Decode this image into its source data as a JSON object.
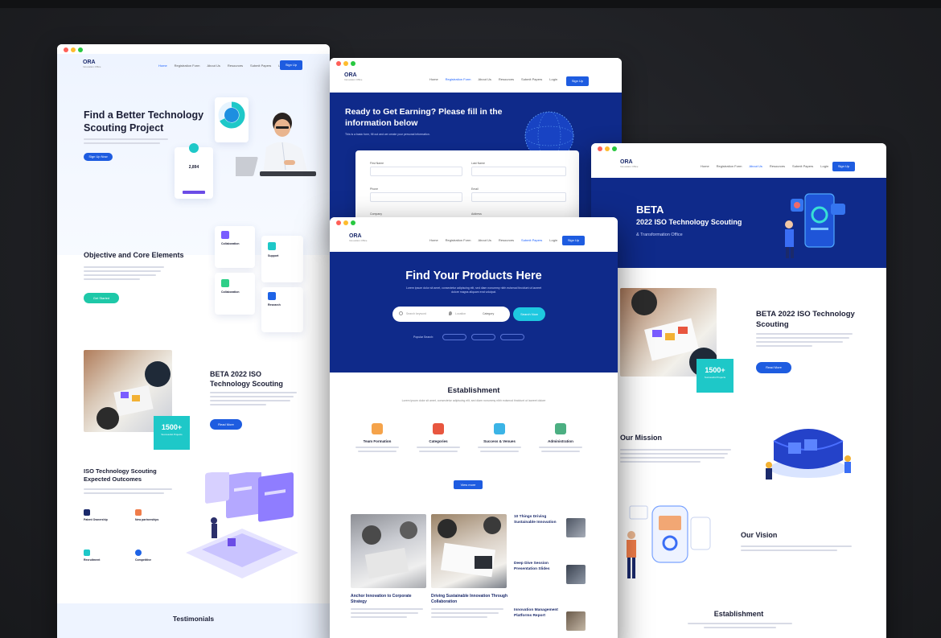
{
  "colors": {
    "brand_blue": "#0f2a8a",
    "accent_blue": "#1e5ce0",
    "teal": "#1ec8c8",
    "background": "#1f2024"
  },
  "nav": {
    "logo": "ORA",
    "links": [
      "Home",
      "Registration Form",
      "About Us",
      "Resources",
      "Submit Papers",
      "Login"
    ],
    "signup": "Sign Up"
  },
  "w1": {
    "hero_title": "Find a Better Technology Scouting Project",
    "hero_btn": "Sign Up Now",
    "stat_card_value": "2,894",
    "objective_title": "Objective and Core Elements",
    "objective_btn": "Get Started",
    "feature_cards": [
      {
        "title": "Collaboration",
        "icon": "puzzle-icon"
      },
      {
        "title": "Support",
        "icon": "chat-icon"
      },
      {
        "title": "Collaboration",
        "icon": "handshake-icon"
      },
      {
        "title": "Research",
        "icon": "search-icon"
      }
    ],
    "beta_title": "BETA 2022 ISO Technology Scouting",
    "beta_btn": "Read More",
    "badge_value": "1500+",
    "badge_label": "Successful Projects",
    "outcomes_title": "ISO Technology Scouting Expected Outcomes",
    "outcome_items": [
      "Patent Ownership",
      "New partnerships",
      "Recruitment",
      "Competitive"
    ],
    "testimonials_title": "Testimonials"
  },
  "w2": {
    "hero_title": "Ready to Get Earning? Please fill in the information below",
    "hero_sub": "This is a basic form, fill out and we create your personal information.",
    "fields": [
      "First Name",
      "Last Name",
      "Phone",
      "Email",
      "Company",
      "Address"
    ]
  },
  "w3": {
    "hero_title": "BETA",
    "hero_sub": "2022 ISO Technology Scouting",
    "hero_sub2": "& Transformation Office",
    "beta_title": "BETA 2022 ISO Technology Scouting",
    "badge_value": "1500+",
    "badge_label": "Successful Projects",
    "beta_btn": "Read More",
    "mission_title": "Our Mission",
    "vision_title": "Our Vision",
    "establishment_title": "Establishment"
  },
  "w4": {
    "hero_title": "Find Your Products Here",
    "hero_sub": "Lorem ipsum dolor sit amet, consectetur adipiscing elit, sed diam nonummy nibh euismod tincidunt ut laoreet dolore magna aliquam erat volutpat.",
    "search_placeholder": "Search keyword",
    "location_placeholder": "Location",
    "category_placeholder": "Category",
    "search_btn": "Search Now",
    "popular_label": "Popular Search:",
    "establishment_title": "Establishment",
    "establishment_sub": "Lorem ipsum dolor sit amet, consectetur adipiscing elit, sed diam nonummy nibh euismod tincidunt ut laoreet dolore",
    "categories": [
      {
        "title": "Team Formation",
        "color": "#f5a34a"
      },
      {
        "title": "Categories",
        "color": "#e8563f"
      },
      {
        "title": "Success & Venues",
        "color": "#3bb4e6"
      },
      {
        "title": "Administration",
        "color": "#4caf82"
      }
    ],
    "establishment_btn": "View more",
    "posts": [
      {
        "title": "Anchor Innovation to Corporate Strategy"
      },
      {
        "title": "Driving Sustainable Innovation Through Collaboration"
      }
    ],
    "side_posts": [
      {
        "title": "10 Things Driving Sustainable Innovation"
      },
      {
        "title": "Deep Dive Session Presentation Slides"
      },
      {
        "title": "Innovation Management Platforms Report"
      }
    ]
  }
}
